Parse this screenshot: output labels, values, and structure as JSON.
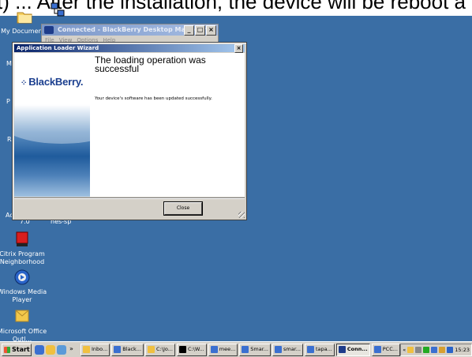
{
  "banner": {
    "text": "t) ... After the installation, the device will be reboot a"
  },
  "desktop": {
    "icons": [
      {
        "name": "my-documents-icon",
        "label": "My Documents"
      },
      {
        "name": "citrix-program-neighborhood-icon",
        "label": "Citrix Program Neighborhood"
      },
      {
        "name": "windows-media-player-icon",
        "label": "Windows Media Player"
      },
      {
        "name": "microsoft-office-outlook-icon",
        "label": "Microsoft Office Outl..."
      }
    ],
    "partial_labels": {
      "m": "M",
      "p": "P",
      "r": "R",
      "ac": "Ac",
      "seven_o": "7.0",
      "hes_sp": "hes-sp"
    }
  },
  "background_window": {
    "title": "Connected - BlackBerry Desktop Manager",
    "menu": [
      "File",
      "View",
      "Options",
      "Help"
    ],
    "controls": [
      "_",
      "□",
      "×"
    ]
  },
  "dialog": {
    "title": "Application Loader Wizard",
    "close_glyph": "×",
    "logo_text": "BlackBerry.",
    "heading": "The loading operation was successful",
    "message": "Your device's software has been updated successfully.",
    "close_button": "Close"
  },
  "taskbar": {
    "start_label": "Start",
    "chevron": "»",
    "tasks": [
      {
        "label": "Inbo...",
        "icon_color": "#f0c040",
        "active": false
      },
      {
        "label": "Black...",
        "icon_color": "#3a6fd0",
        "active": false
      },
      {
        "label": "C:\\Jo...",
        "icon_color": "#f0c040",
        "active": false
      },
      {
        "label": "C:\\W...",
        "icon_color": "#000000",
        "active": false
      },
      {
        "label": "mee...",
        "icon_color": "#3a6fd0",
        "active": false
      },
      {
        "label": "Smar...",
        "icon_color": "#3a6fd0",
        "active": false
      },
      {
        "label": "smar...",
        "icon_color": "#3a6fd0",
        "active": false
      },
      {
        "label": "tapa...",
        "icon_color": "#3a6fd0",
        "active": false
      },
      {
        "label": "Conn...",
        "icon_color": "#1e3c8a",
        "active": true
      },
      {
        "label": "PCC...",
        "icon_color": "#3a6fd0",
        "active": false
      }
    ],
    "tray": {
      "chevron": "«",
      "clock": "15:23"
    }
  }
}
